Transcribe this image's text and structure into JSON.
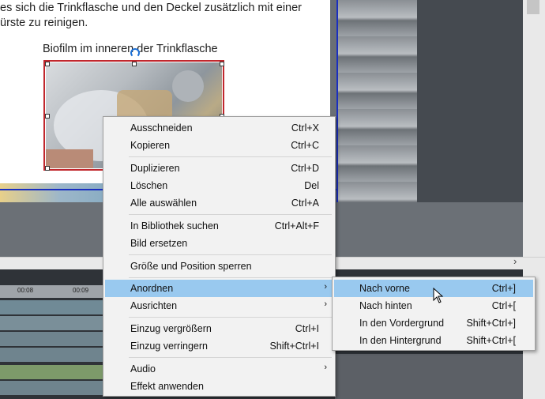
{
  "document": {
    "text_line1": "es sich die Trinkflasche und den Deckel zusätzlich mit einer",
    "text_line2": "ürste zu reinigen.",
    "caption": "Biofilm im inneren der Trinkflasche"
  },
  "timeline": {
    "ticks": [
      "00:08",
      "00:09"
    ]
  },
  "context_menu": {
    "items": [
      {
        "label": "Ausschneiden",
        "shortcut": "Ctrl+X"
      },
      {
        "label": "Kopieren",
        "shortcut": "Ctrl+C"
      },
      {
        "label": "Duplizieren",
        "shortcut": "Ctrl+D"
      },
      {
        "label": "Löschen",
        "shortcut": "Del"
      },
      {
        "label": "Alle auswählen",
        "shortcut": "Ctrl+A"
      },
      {
        "label": "In Bibliothek suchen",
        "shortcut": "Ctrl+Alt+F"
      },
      {
        "label": "Bild ersetzen",
        "shortcut": ""
      },
      {
        "label": "Größe und Position sperren",
        "shortcut": ""
      },
      {
        "label": "Anordnen",
        "shortcut": ""
      },
      {
        "label": "Ausrichten",
        "shortcut": ""
      },
      {
        "label": "Einzug vergrößern",
        "shortcut": "Ctrl+I"
      },
      {
        "label": "Einzug verringern",
        "shortcut": "Shift+Ctrl+I"
      },
      {
        "label": "Audio",
        "shortcut": ""
      },
      {
        "label": "Effekt anwenden",
        "shortcut": ""
      }
    ]
  },
  "submenu": {
    "items": [
      {
        "label": "Nach vorne",
        "shortcut": "Ctrl+]"
      },
      {
        "label": "Nach hinten",
        "shortcut": "Ctrl+["
      },
      {
        "label": "In den Vordergrund",
        "shortcut": "Shift+Ctrl+]"
      },
      {
        "label": "In den Hintergrund",
        "shortcut": "Shift+Ctrl+["
      }
    ]
  },
  "colors": {
    "highlight": "#99c9ef",
    "selection_frame": "#c1272d",
    "guide_line": "#1a2fc0"
  }
}
